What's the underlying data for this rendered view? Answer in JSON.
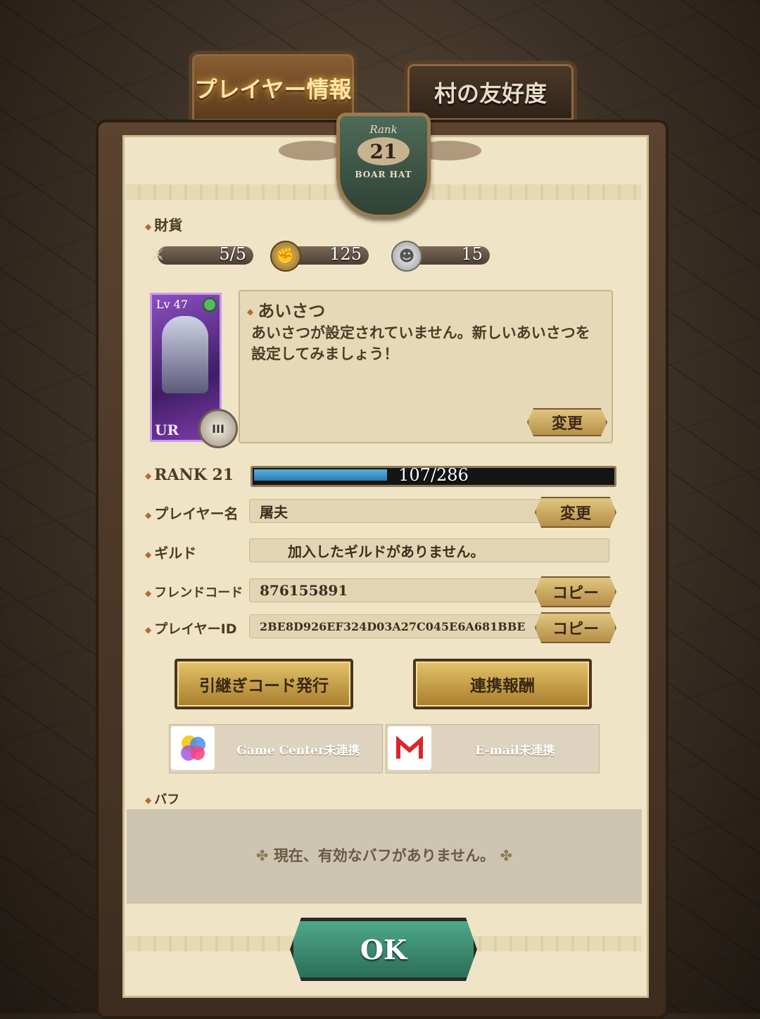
{
  "tabs": {
    "player_info": "プレイヤー情報",
    "village_friendship": "村の友好度"
  },
  "rank_badge": {
    "label": "Rank",
    "value": "21",
    "guild_label": "BOAR HAT"
  },
  "currency": {
    "label": "財貨",
    "stamina": "5/5",
    "coins": "125",
    "silver": "15"
  },
  "card": {
    "level": "Lv 47",
    "rarity": "UR",
    "attribute": "III"
  },
  "greeting": {
    "title": "あいさつ",
    "text": "あいさつが設定されていません。新しいあいさつを設定してみましょう！",
    "change_button": "変更"
  },
  "rank": {
    "label": "RANK 21",
    "exp_text": "107/286",
    "progress": 0.374
  },
  "player_name": {
    "label": "プレイヤー名",
    "value": "屠夫",
    "change_button": "変更"
  },
  "guild": {
    "label": "ギルド",
    "value": "加入したギルドがありません。"
  },
  "friend_code": {
    "label": "フレンドコード",
    "value": "876155891",
    "copy_button": "コピー"
  },
  "player_id": {
    "label": "プレイヤーID",
    "value": "2BE8D926EF324D03A27C045E6A681BBE",
    "copy_button": "コピー"
  },
  "actions": {
    "transfer_code": "引継ぎコード発行",
    "link_reward": "連携報酬"
  },
  "links": {
    "game_center": "Game Center未連携",
    "email": "E-mail未連携"
  },
  "buff": {
    "label": "バフ",
    "message": "現在、有効なバフがありません。"
  },
  "ok_button": "OK"
}
